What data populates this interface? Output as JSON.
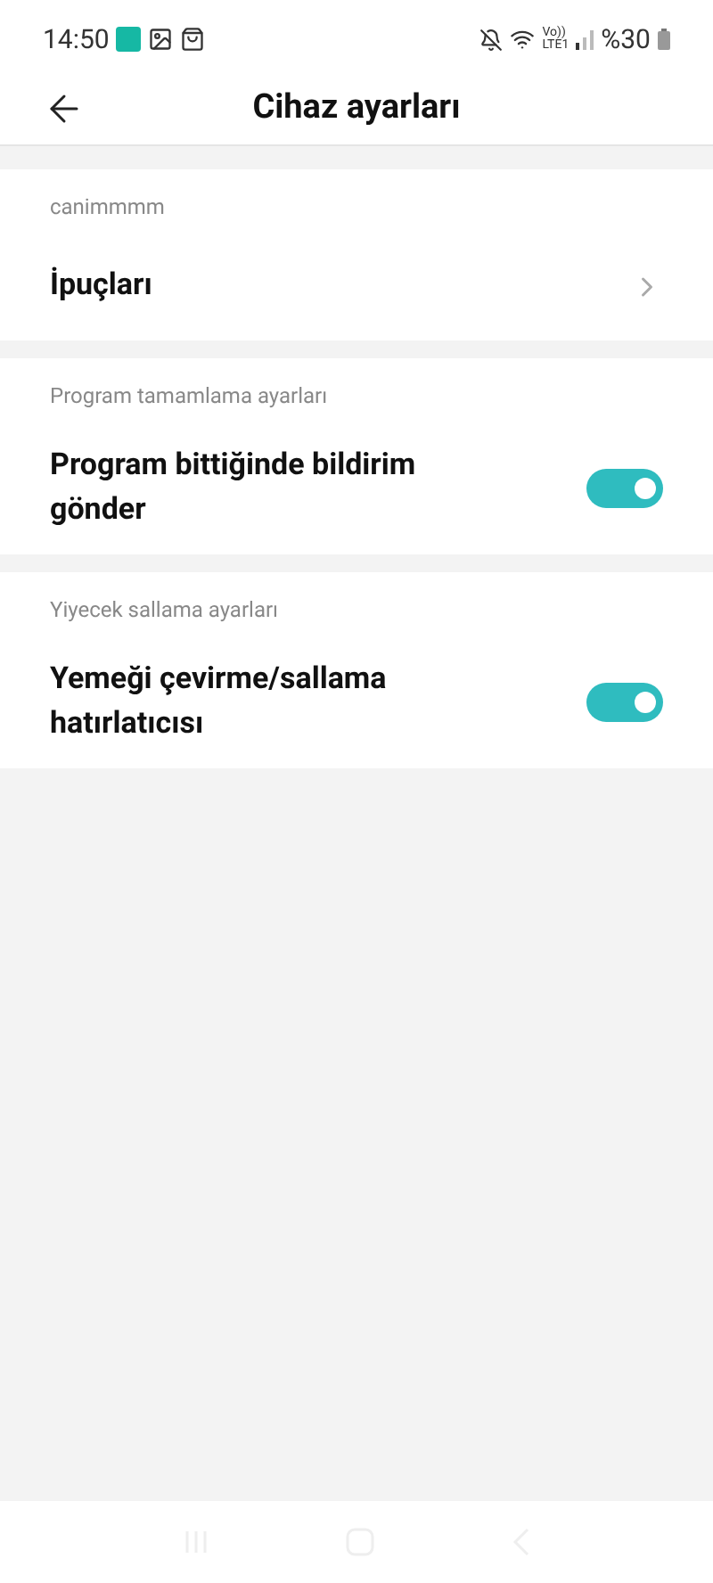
{
  "status_bar": {
    "time": "14:50",
    "volte": "Vo))",
    "lte": "LTE1",
    "battery": "%30"
  },
  "header": {
    "title": "Cihaz ayarları"
  },
  "sections": [
    {
      "title": "canimmmm",
      "rows": [
        {
          "kind": "link",
          "label": "İpuçları"
        }
      ]
    },
    {
      "title": "Program tamamlama ayarları",
      "rows": [
        {
          "kind": "toggle",
          "label": "Program bittiğinde bildirim gönder",
          "on": true
        }
      ]
    },
    {
      "title": "Yiyecek sallama ayarları",
      "rows": [
        {
          "kind": "toggle",
          "label": "Yemeği çevirme/sallama hatırlatıcısı",
          "on": true
        }
      ]
    }
  ]
}
